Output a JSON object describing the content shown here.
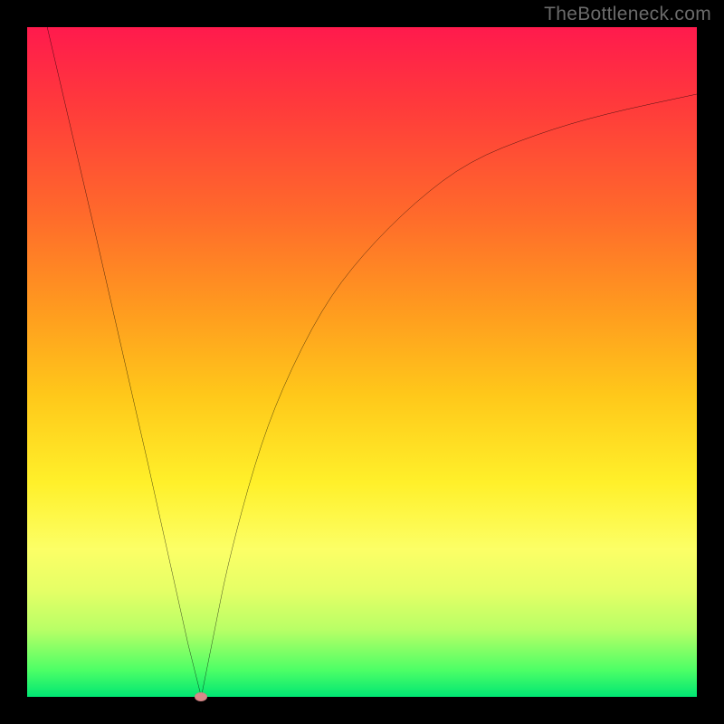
{
  "watermark": "TheBottleneck.com",
  "colors": {
    "frame_background": "#000000",
    "gradient_top": "#ff1a4d",
    "gradient_mid": "#ffe033",
    "gradient_bottom": "#00e673",
    "curve": "#000000",
    "marker": "#d88a8a",
    "watermark_text": "#6b6b6b"
  },
  "chart_data": {
    "type": "line",
    "title": "",
    "xlabel": "",
    "ylabel": "",
    "xlim": [
      0,
      100
    ],
    "ylim": [
      0,
      100
    ],
    "grid": false,
    "legend": false,
    "annotations": [
      "TheBottleneck.com"
    ],
    "marker": {
      "x": 26,
      "y": 0
    },
    "series": [
      {
        "name": "left-branch",
        "x": [
          3,
          10,
          18,
          24,
          26
        ],
        "y": [
          100,
          70,
          35,
          8,
          0
        ]
      },
      {
        "name": "right-branch",
        "x": [
          26,
          28,
          30,
          34,
          38,
          44,
          50,
          58,
          66,
          76,
          86,
          100
        ],
        "y": [
          0,
          10,
          20,
          35,
          46,
          58,
          66,
          74,
          80,
          84,
          87,
          90
        ]
      }
    ]
  }
}
